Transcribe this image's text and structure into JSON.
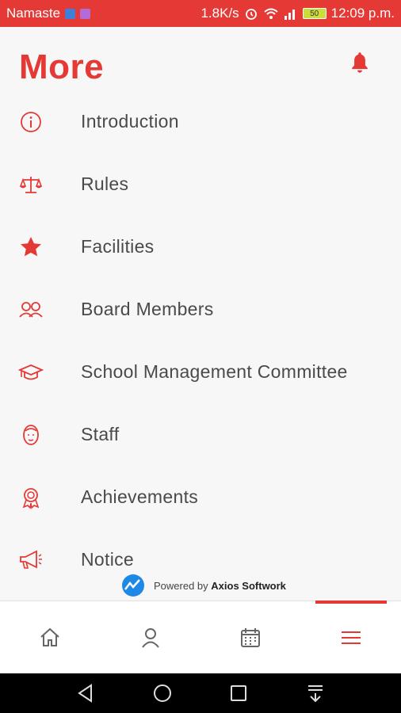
{
  "status_bar": {
    "carrier": "Namaste",
    "speed": "1.8K/s",
    "battery": "50",
    "time": "12:09 p.m."
  },
  "header": {
    "title": "More",
    "bell_icon": "bell-icon"
  },
  "menu": {
    "items": [
      {
        "label": "Introduction",
        "icon": "info-icon"
      },
      {
        "label": "Rules",
        "icon": "scale-icon"
      },
      {
        "label": "Facilities",
        "icon": "star-icon"
      },
      {
        "label": "Board Members",
        "icon": "people-icon"
      },
      {
        "label": "School Management Committee",
        "icon": "graduation-cap-icon"
      },
      {
        "label": "Staff",
        "icon": "face-icon"
      },
      {
        "label": "Achievements",
        "icon": "award-icon"
      },
      {
        "label": "Notice",
        "icon": "megaphone-icon"
      }
    ]
  },
  "footer": {
    "powered_prefix": "Powered by",
    "powered_brand": "Axios Softwork"
  },
  "tabbar": {
    "tabs": [
      {
        "name": "home",
        "icon": "home-icon"
      },
      {
        "name": "profile",
        "icon": "user-icon"
      },
      {
        "name": "calendar",
        "icon": "calendar-icon"
      },
      {
        "name": "more",
        "icon": "menu-icon",
        "active": true
      }
    ]
  },
  "colors": {
    "accent": "#e53935",
    "text": "#4a4a4a"
  }
}
